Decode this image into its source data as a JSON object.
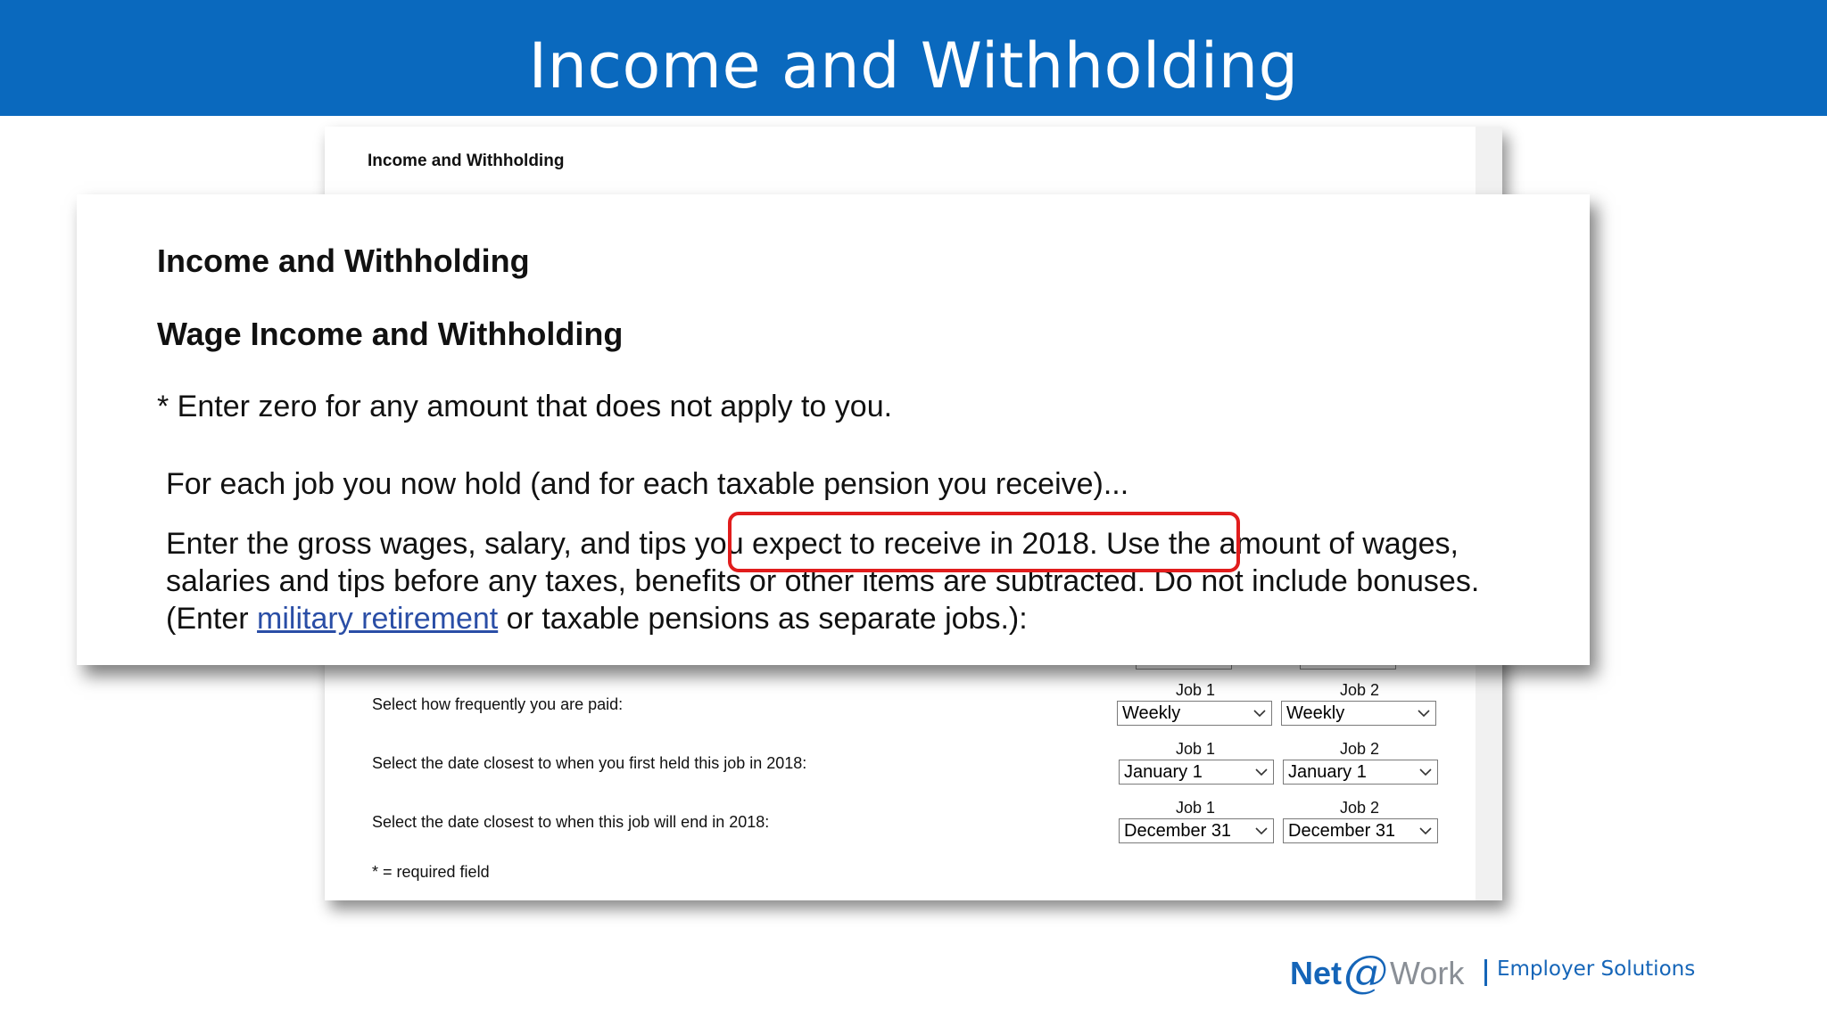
{
  "slide": {
    "title": "Income and Withholding"
  },
  "back_form": {
    "heading": "Income and Withholding",
    "rows": [
      {
        "label": "Select how frequently you are paid:",
        "job1_label": "Job 1",
        "job2_label": "Job 2",
        "job1_value": "Weekly",
        "job2_value": "Weekly"
      },
      {
        "label": "Select the date closest to when you first held this job in 2018:",
        "job1_label": "Job 1",
        "job2_label": "Job 2",
        "job1_value": "January 1",
        "job2_value": "January 1"
      },
      {
        "label": "Select the date closest to when this job will end in 2018:",
        "job1_label": "Job 1",
        "job2_label": "Job 2",
        "job1_value": "December 31",
        "job2_value": "December 31"
      }
    ],
    "required_note": "* = required field"
  },
  "zoom_panel": {
    "heading": "Income and Withholding",
    "subheading": "Wage Income and Withholding",
    "note": "* Enter zero for any amount that does not apply to you.",
    "line1": "For each job you now hold (and for each taxable pension you receive)...",
    "para_part1": "Enter the gross wages, salary, and tips ",
    "para_highlight": "you expect to receive in 2018.",
    "para_part2": " Use the amount of wages, salaries and tips before any taxes, benefits or other items are subtracted. Do not include bonuses. (Enter ",
    "para_link": "military retirement",
    "para_part3": " or taxable pensions as separate jobs.):",
    "highlight_color": "#e11d1d",
    "link_color": "#2a4ea6"
  },
  "footer": {
    "logo_net": "Net",
    "logo_at": "@",
    "logo_work": "Work",
    "tagline": "Employer Solutions"
  },
  "colors": {
    "banner": "#0a69be",
    "brand_blue": "#1565b8"
  }
}
